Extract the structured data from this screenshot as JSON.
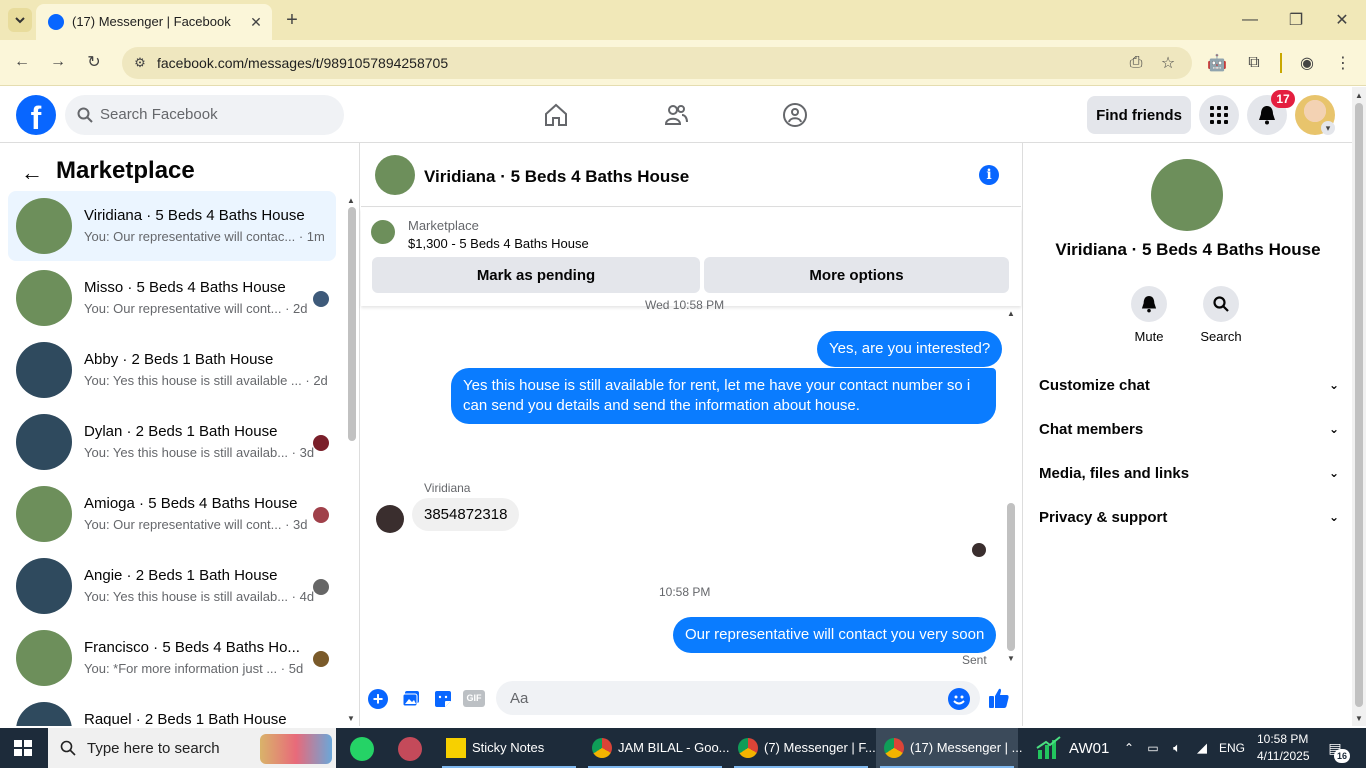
{
  "browser": {
    "tab_title": "(17) Messenger | Facebook",
    "url": "facebook.com/messages/t/9891057894258705"
  },
  "fb_header": {
    "search_placeholder": "Search Facebook",
    "find_friends": "Find friends",
    "notification_count": "17",
    "brand_color": "#0866ff"
  },
  "sidebar": {
    "title": "Marketplace",
    "conversations": [
      {
        "name": "Viridiana · 5 Beds 4 Baths House",
        "snippet": "You: Our representative will contac... · 1m",
        "active": true
      },
      {
        "name": "Misso · 5 Beds 4 Baths House",
        "snippet": "You: Our representative will cont... · 2d"
      },
      {
        "name": "Abby · 2 Beds 1 Bath House",
        "snippet": "You: Yes this house is still available ... · 2d"
      },
      {
        "name": "Dylan · 2 Beds 1 Bath House",
        "snippet": "You: Yes this house is still availab... · 3d"
      },
      {
        "name": "Amioga · 5 Beds 4 Baths House",
        "snippet": "You: Our representative will cont... · 3d"
      },
      {
        "name": "Angie · 2 Beds 1 Bath House",
        "snippet": "You: Yes this house is still availab... · 4d"
      },
      {
        "name": "Francisco · 5 Beds 4 Baths Ho...",
        "snippet": "You: *For more information just ... · 5d"
      },
      {
        "name": "Raquel · 2 Beds 1 Bath House",
        "snippet": ""
      }
    ]
  },
  "chat": {
    "title": "Viridiana · 5 Beds 4 Baths House",
    "marketplace_label": "Marketplace",
    "listing": "$1,300 - 5 Beds 4 Baths House",
    "mark_pending": "Mark as pending",
    "more_options": "More options",
    "time_top": "Wed 10:58 PM",
    "msg1": "Yes, are you interested?",
    "msg2": "Yes this house is still available for rent, let me have your contact number so i can send you details and send the information about house.",
    "sender_name": "Viridiana",
    "msg3": "3854872318",
    "time_bottom": "10:58 PM",
    "msg4": "Our representative will contact you very soon",
    "sent_status": "Sent",
    "composer_placeholder": "Aa",
    "gif_label": "GIF"
  },
  "details": {
    "name": "Viridiana · 5 Beds 4 Baths House",
    "mute": "Mute",
    "search": "Search",
    "sections": [
      "Customize chat",
      "Chat members",
      "Media, files and links",
      "Privacy & support"
    ]
  },
  "taskbar": {
    "search_placeholder": "Type here to search",
    "apps": [
      "Sticky Notes",
      "JAM BILAL - Goo...",
      "(7) Messenger | F...",
      "(17) Messenger | ..."
    ],
    "tray_label": "AW01",
    "lang": "ENG",
    "time": "10:58 PM",
    "date": "4/11/2025",
    "notif_count": "16"
  }
}
